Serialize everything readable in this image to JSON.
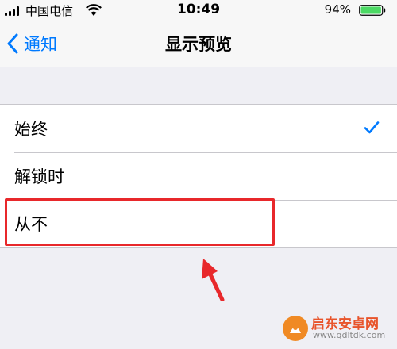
{
  "status_bar": {
    "carrier": "中国电信",
    "time": "10:49",
    "battery_percent": "94%",
    "battery_level": 0.94,
    "signal_icon": "signal-bars-icon",
    "wifi_icon": "wifi-icon"
  },
  "nav": {
    "back_label": "通知",
    "title": "显示预览"
  },
  "options": [
    {
      "label": "始终",
      "selected": true
    },
    {
      "label": "解锁时",
      "selected": false
    },
    {
      "label": "从不",
      "selected": false
    }
  ],
  "annotation": {
    "highlight_color": "#e8282b",
    "highlighted_option": "从不"
  },
  "watermark": {
    "name": "启东安卓网",
    "url": "www.qdltdk.com"
  },
  "colors": {
    "accent": "#007aff",
    "battery": "#4cd964",
    "background": "#efeff4"
  }
}
